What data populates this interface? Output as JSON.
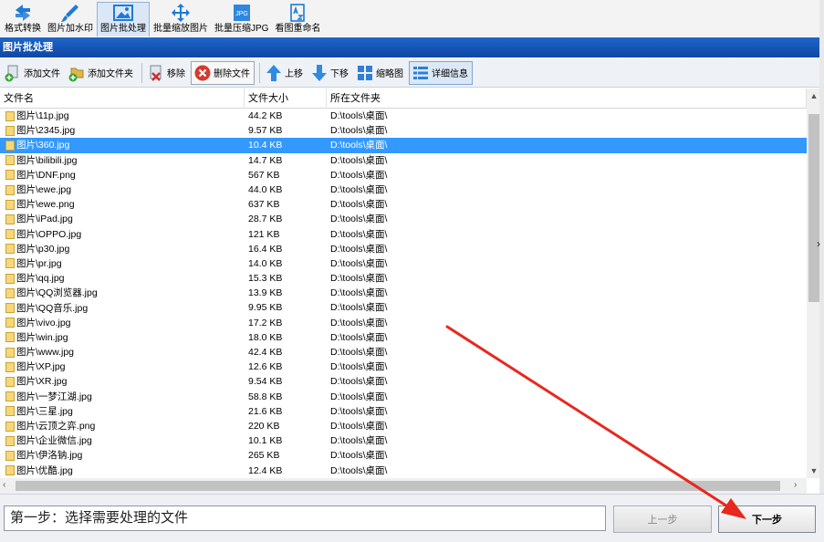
{
  "top_toolbar": {
    "items": [
      {
        "label": "格式转换",
        "icon": "convert-icon"
      },
      {
        "label": "图片加水印",
        "icon": "brush-icon"
      },
      {
        "label": "图片批处理",
        "icon": "image-icon",
        "active": true
      },
      {
        "label": "批量缩放图片",
        "icon": "move-arrows-icon"
      },
      {
        "label": "批量压缩JPG",
        "icon": "jpg-file-icon",
        "badge": "JPG"
      },
      {
        "label": "看图重命名",
        "icon": "rename-icon"
      }
    ]
  },
  "window_title": "图片批处理",
  "sub_toolbar": {
    "add_file": "添加文件",
    "add_folder": "添加文件夹",
    "remove": "移除",
    "delete_file": "删除文件",
    "move_up": "上移",
    "move_down": "下移",
    "thumbnail": "缩略图",
    "details": "详细信息"
  },
  "table": {
    "columns": [
      "文件名",
      "文件大小",
      "所在文件夹"
    ],
    "selected_index": 2,
    "rows": [
      {
        "name": "图片\\11p.jpg",
        "size": "44.2 KB",
        "folder": "D:\\tools\\桌面\\"
      },
      {
        "name": "图片\\2345.jpg",
        "size": "9.57 KB",
        "folder": "D:\\tools\\桌面\\"
      },
      {
        "name": "图片\\360.jpg",
        "size": "10.4 KB",
        "folder": "D:\\tools\\桌面\\"
      },
      {
        "name": "图片\\bilibili.jpg",
        "size": "14.7 KB",
        "folder": "D:\\tools\\桌面\\"
      },
      {
        "name": "图片\\DNF.png",
        "size": "567 KB",
        "folder": "D:\\tools\\桌面\\"
      },
      {
        "name": "图片\\ewe.jpg",
        "size": "44.0 KB",
        "folder": "D:\\tools\\桌面\\"
      },
      {
        "name": "图片\\ewe.png",
        "size": "637 KB",
        "folder": "D:\\tools\\桌面\\"
      },
      {
        "name": "图片\\iPad.jpg",
        "size": "28.7 KB",
        "folder": "D:\\tools\\桌面\\"
      },
      {
        "name": "图片\\OPPO.jpg",
        "size": "121 KB",
        "folder": "D:\\tools\\桌面\\"
      },
      {
        "name": "图片\\p30.jpg",
        "size": "16.4 KB",
        "folder": "D:\\tools\\桌面\\"
      },
      {
        "name": "图片\\pr.jpg",
        "size": "14.0 KB",
        "folder": "D:\\tools\\桌面\\"
      },
      {
        "name": "图片\\qq.jpg",
        "size": "15.3 KB",
        "folder": "D:\\tools\\桌面\\"
      },
      {
        "name": "图片\\QQ浏览器.jpg",
        "size": "13.9 KB",
        "folder": "D:\\tools\\桌面\\"
      },
      {
        "name": "图片\\QQ音乐.jpg",
        "size": "9.95 KB",
        "folder": "D:\\tools\\桌面\\"
      },
      {
        "name": "图片\\vivo.jpg",
        "size": "17.2 KB",
        "folder": "D:\\tools\\桌面\\"
      },
      {
        "name": "图片\\win.jpg",
        "size": "18.0 KB",
        "folder": "D:\\tools\\桌面\\"
      },
      {
        "name": "图片\\www.jpg",
        "size": "42.4 KB",
        "folder": "D:\\tools\\桌面\\"
      },
      {
        "name": "图片\\XP.jpg",
        "size": "12.6 KB",
        "folder": "D:\\tools\\桌面\\"
      },
      {
        "name": "图片\\XR.jpg",
        "size": "9.54 KB",
        "folder": "D:\\tools\\桌面\\"
      },
      {
        "name": "图片\\一梦江湖.jpg",
        "size": "58.8 KB",
        "folder": "D:\\tools\\桌面\\"
      },
      {
        "name": "图片\\三星.jpg",
        "size": "21.6 KB",
        "folder": "D:\\tools\\桌面\\"
      },
      {
        "name": "图片\\云顶之弈.png",
        "size": "220 KB",
        "folder": "D:\\tools\\桌面\\"
      },
      {
        "name": "图片\\企业微信.jpg",
        "size": "10.1 KB",
        "folder": "D:\\tools\\桌面\\"
      },
      {
        "name": "图片\\伊洛钠.jpg",
        "size": "265 KB",
        "folder": "D:\\tools\\桌面\\"
      },
      {
        "name": "图片\\优酷.jpg",
        "size": "12.4 KB",
        "folder": "D:\\tools\\桌面\\"
      }
    ]
  },
  "bottom": {
    "step_text": "第一步：选择需要处理的文件",
    "prev_label": "上一步",
    "next_label": "下一步"
  },
  "colors": {
    "title_bar": "#1456b8",
    "selected_row": "#3399ff",
    "annotation_arrow": "#e8281e"
  }
}
